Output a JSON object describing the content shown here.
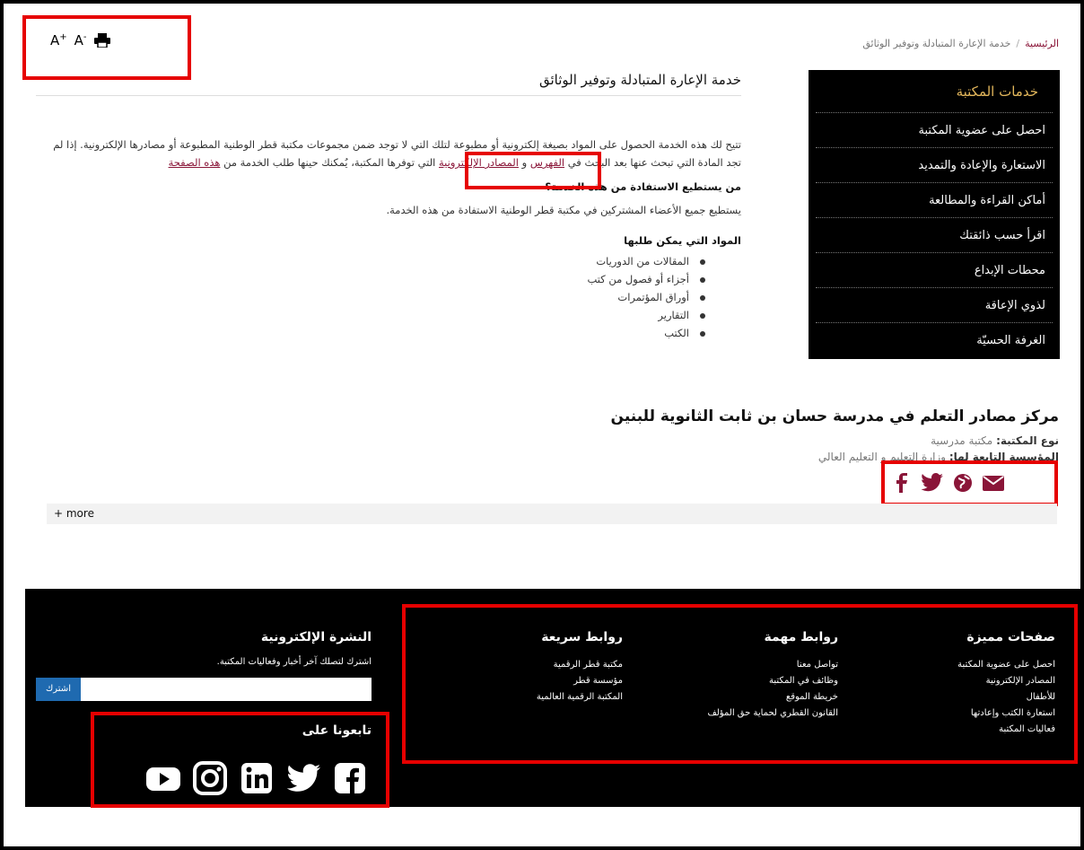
{
  "tools": {
    "font_increase": "A",
    "font_increase_sup": "+",
    "font_decrease": "A",
    "font_decrease_sup": "-"
  },
  "breadcrumb": {
    "home": "الرئيسية",
    "sep": "/",
    "current": "خدمة الإعارة المتبادلة وتوفير الوثائق"
  },
  "sidebar": {
    "title": "خدمات المكتبة",
    "items": [
      "احصل على عضوية المكتبة",
      "الاستعارة والإعادة والتمديد",
      "أماكن القراءة والمطالعة",
      "اقرأ حسب ذائقتك",
      "محطات الإبداع",
      "لذوي الإعاقة",
      "الغرفة الحسيّة"
    ]
  },
  "content": {
    "title": "خدمة الإعارة المتبادلة وتوفير الوثائق",
    "intro_a": "تتيح لك هذه الخدمة الحصول على المواد بصيغة إلكترونية أو مطبوعة لتلك التي لا توجد ضمن مجموعات مكتبة قطر الوطنية المطبوعة أو مصادرها الإلكترونية. إذا لم تجد المادة التي تبحث عنها بعد البحث في ",
    "link_catalog": "الفهرس",
    "intro_and": " و ",
    "link_eresources": "المصادر الإلكترونية",
    "intro_b": " التي توفرها المكتبة، يُمكنك حينها طلب الخدمة من ",
    "link_page": "هذه الصفحة",
    "who_heading": "من يستطيع الاستفادة من هذه الخدمة؟",
    "who_text": "يستطيع جميع الأعضاء المشتركين في مكتبة قطر الوطنية الاستفادة من هذه الخدمة.",
    "materials_heading": "المواد التي يمكن طلبها",
    "materials": [
      "المقالات من الدوريات",
      "أجزاء أو فصول من كتب",
      "أوراق المؤتمرات",
      "التقارير",
      "الكتب"
    ]
  },
  "center": {
    "title": "مركز مصادر التعلم في مدرسة حسان بن ثابت الثانوية للبنين",
    "type_label": "نوع المكتبة:",
    "type_value": "مكتبة مدرسية",
    "org_label": "المؤسسة التابعة لها:",
    "org_value": "وزارة التعليم و التعليم العالي",
    "more": "+ more"
  },
  "footer": {
    "featured": {
      "title": "صفحات مميزة",
      "links": [
        "احصل على عضوية المكتبة",
        "المصادر الإلكترونية",
        "للأطفال",
        "استعارة الكتب وإعادتها",
        "فعاليات المكتبة"
      ]
    },
    "important": {
      "title": "روابط مهمة",
      "links": [
        "تواصل معنا",
        "وظائف في المكتبة",
        "خريطة الموقع",
        "القانون القطري لحماية حق المؤلف"
      ]
    },
    "quick": {
      "title": "روابط سريعة",
      "links": [
        "مكتبة قطر الرقمية",
        "مؤسسة قطر",
        "المكتبة الرقمية العالمية"
      ]
    },
    "newsletter": {
      "title": "النشرة الإلكترونية",
      "text": "اشترك لتصلك آخر أخبار وفعاليات المكتبة.",
      "button": "اشترك"
    },
    "follow": "تابعونا على"
  },
  "colors": {
    "brand": "#8a1538",
    "gold": "#e2b65b",
    "highlight": "#e60000",
    "subscribe": "#1f6ab0"
  }
}
